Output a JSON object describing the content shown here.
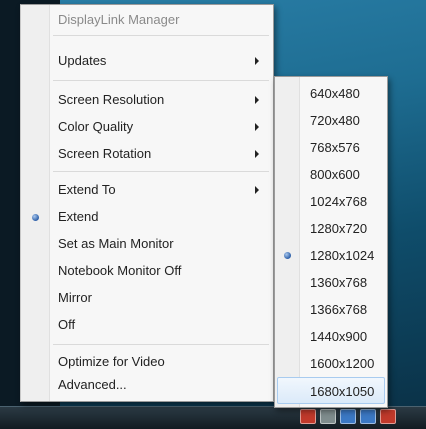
{
  "menu": {
    "header": "DisplayLink Manager",
    "updates": "Updates",
    "screen_resolution": "Screen Resolution",
    "color_quality": "Color Quality",
    "screen_rotation": "Screen Rotation",
    "extend_to": "Extend To",
    "extend": "Extend",
    "set_main": "Set as Main Monitor",
    "notebook_off": "Notebook Monitor Off",
    "mirror": "Mirror",
    "off": "Off",
    "optimize": "Optimize for Video",
    "advanced": "Advanced..."
  },
  "resolutions": [
    "640x480",
    "720x480",
    "768x576",
    "800x600",
    "1024x768",
    "1280x720",
    "1280x1024",
    "1360x768",
    "1366x768",
    "1440x900",
    "1600x1200",
    "1680x1050"
  ],
  "selected_resolution": "1280x1024",
  "colors": {
    "bullet": "#2d5fa8",
    "highlight": "#dbeaf9"
  }
}
